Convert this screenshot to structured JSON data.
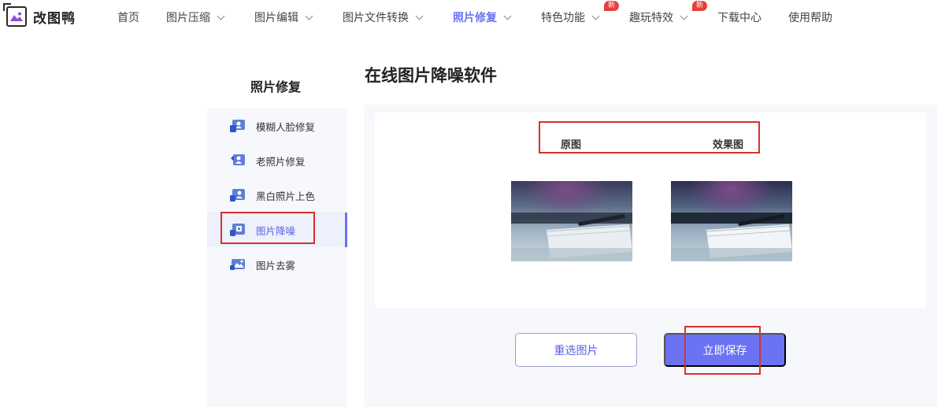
{
  "brand": {
    "name": "改图鸭"
  },
  "nav": {
    "items": [
      {
        "label": "首页"
      },
      {
        "label": "图片压缩"
      },
      {
        "label": "图片编辑"
      },
      {
        "label": "图片文件转换"
      },
      {
        "label": "照片修复"
      },
      {
        "label": "特色功能",
        "badge": "新"
      },
      {
        "label": "趣玩特效",
        "badge": "新"
      },
      {
        "label": "下载中心"
      },
      {
        "label": "使用帮助"
      }
    ],
    "active_index": 4,
    "accent_color": "#6b73f2",
    "badge_color": "#e5403a"
  },
  "sidebar": {
    "title": "照片修复",
    "items": [
      {
        "label": "模糊人脸修复",
        "icon": "face-photo-icon"
      },
      {
        "label": "老照片修复",
        "icon": "old-photo-icon"
      },
      {
        "label": "黑白照片上色",
        "icon": "colorize-icon"
      },
      {
        "label": "图片降噪",
        "icon": "denoise-icon"
      },
      {
        "label": "图片去雾",
        "icon": "dehaze-icon"
      }
    ],
    "active_index": 3
  },
  "main": {
    "title": "在线图片降噪软件",
    "labels": {
      "original": "原图",
      "result": "效果图"
    },
    "buttons": {
      "reselect": "重选图片",
      "save": "立即保存"
    }
  }
}
